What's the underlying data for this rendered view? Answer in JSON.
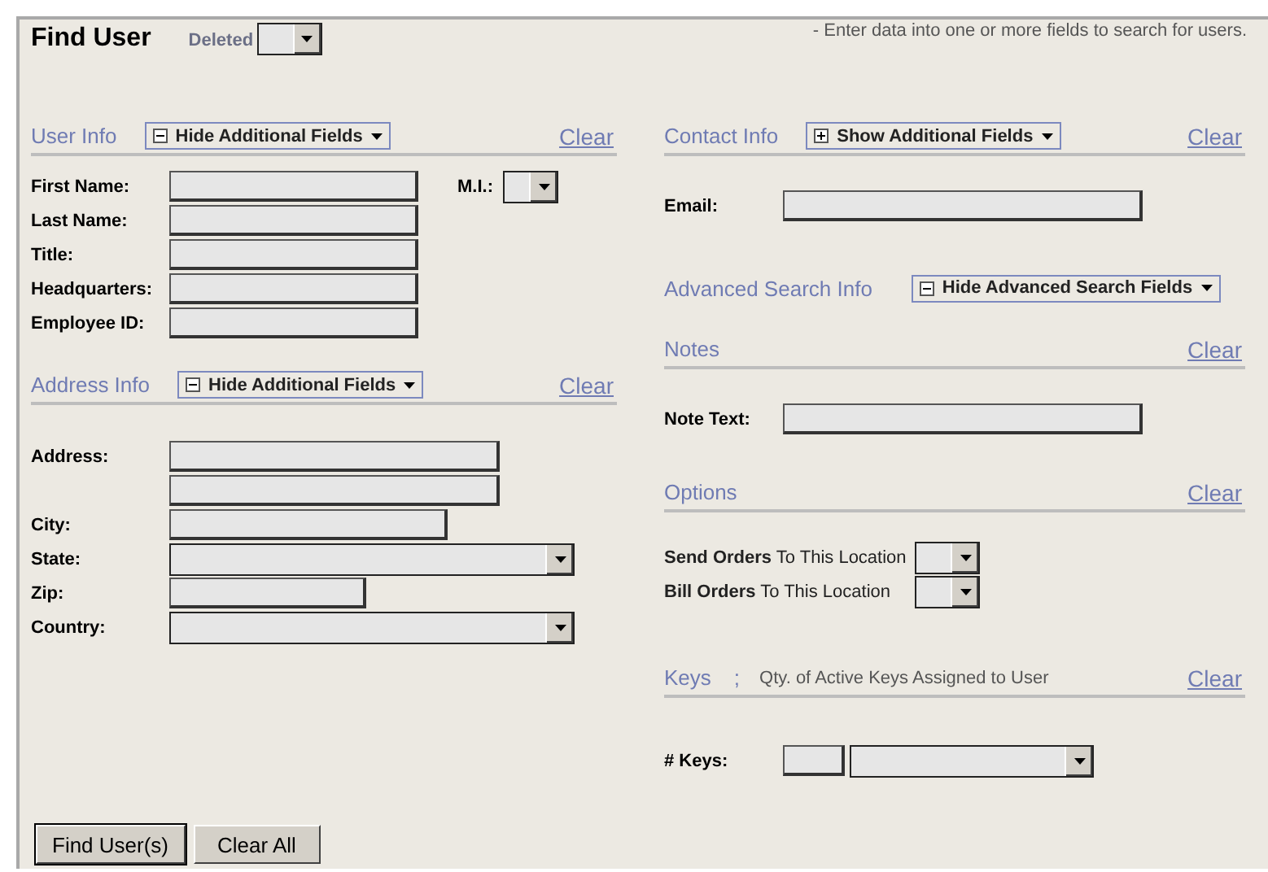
{
  "header": {
    "title": "Find User",
    "deleted_label": "Deleted",
    "hint": "- Enter data into one or more fields to search for users."
  },
  "left_sections": [
    {
      "title": "User Info",
      "toggle": {
        "label": "Hide Additional Fields",
        "expanded": true
      },
      "clear": "Clear",
      "fields": [
        {
          "label": "First Name:",
          "kind": "text",
          "side": {
            "label": "M.I.:",
            "kind": "tiny-select"
          }
        },
        {
          "label": "Last Name:",
          "kind": "text"
        },
        {
          "label": "Title:",
          "kind": "text"
        },
        {
          "label": "Headquarters:",
          "kind": "text"
        },
        {
          "label": "Employee ID:",
          "kind": "text"
        }
      ]
    },
    {
      "title": "Address Info",
      "toggle": {
        "label": "Hide Additional Fields",
        "expanded": true
      },
      "clear": "Clear",
      "fields": [
        {
          "label": "Address:",
          "kind": "long"
        },
        {
          "kind": "long"
        },
        {
          "label": "City:",
          "kind": "mid"
        },
        {
          "label": "State:",
          "kind": "select"
        },
        {
          "label": "Zip:",
          "kind": "short"
        },
        {
          "label": "Country:",
          "kind": "select"
        }
      ]
    }
  ],
  "right_sections": [
    {
      "title": "Contact Info",
      "toggle": {
        "label": "Show Additional Fields",
        "expanded": false
      },
      "clear": "Clear",
      "fields": [
        {
          "label": "Email:",
          "kind": "wide"
        }
      ]
    },
    {
      "title": "Advanced Search Info",
      "toggle": {
        "label": "Hide Advanced Search Fields",
        "expanded": true
      }
    },
    {
      "title": "Notes",
      "clear": "Clear",
      "fields": [
        {
          "label": "Note Text:",
          "kind": "wide"
        }
      ]
    },
    {
      "title": "Options",
      "clear": "Clear",
      "fields": [
        {
          "label": "**Send Orders** To This Location",
          "kind": "option"
        },
        {
          "label": "**Bill Orders** To This Location",
          "kind": "option"
        }
      ]
    },
    {
      "title": "Keys",
      "separator": ";",
      "subtitle": "Qty. of Active Keys Assigned to User",
      "clear": "Clear",
      "fields": [
        {
          "label": "# Keys:",
          "kind": "keys"
        }
      ]
    }
  ],
  "buttons": [
    {
      "label": "Find User(s)",
      "selected": true
    },
    {
      "label": "Clear All",
      "selected": false
    }
  ]
}
